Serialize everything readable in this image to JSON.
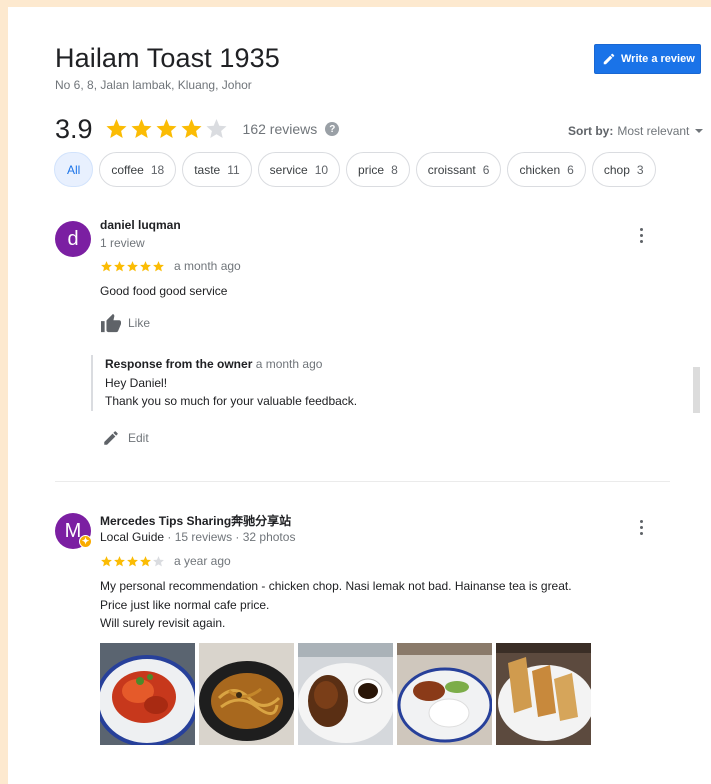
{
  "place": {
    "name": "Hailam Toast 1935",
    "address": "No 6, 8, Jalan lambak, Kluang, Johor",
    "rating": "3.9",
    "stars": 4,
    "reviews_count": "162 reviews",
    "help_icon": "?"
  },
  "write_review": {
    "label": "Write a review",
    "icon": "pencil-icon"
  },
  "sort": {
    "label": "Sort by:",
    "value": "Most relevant"
  },
  "chips": [
    {
      "label": "All",
      "count": ""
    },
    {
      "label": "coffee",
      "count": "18"
    },
    {
      "label": "taste",
      "count": "11"
    },
    {
      "label": "service",
      "count": "10"
    },
    {
      "label": "price",
      "count": "8"
    },
    {
      "label": "croissant",
      "count": "6"
    },
    {
      "label": "chicken",
      "count": "6"
    },
    {
      "label": "chop",
      "count": "3"
    }
  ],
  "reviews": [
    {
      "avatar_letter": "d",
      "avatar_color": "#7b1fa2",
      "name": "daniel luqman",
      "meta": "1 review",
      "stars": 5,
      "time": "a month ago",
      "text": "Good food good service",
      "like_label": "Like",
      "response": {
        "label": "Response from the owner",
        "time": "a month ago",
        "line1": "Hey Daniel!",
        "line2": "Thank you so much for your valuable feedback."
      },
      "edit_label": "Edit"
    },
    {
      "avatar_letter": "M",
      "avatar_color": "#7b1fa2",
      "name": "Mercedes Tips Sharing奔驰分享站",
      "guide": "Local Guide",
      "meta": " · 15 reviews · 32 photos",
      "stars": 4,
      "time": "a year ago",
      "text_line1": "My personal recommendation - chicken chop. Nasi lemak not bad. Hainanse tea is great.",
      "text_line2": "Price just like normal cafe price.",
      "text_line3": "Will surely revisit again.",
      "photos": [
        "chicken-chop-photo",
        "noodles-photo",
        "roast-chicken-photo",
        "nasi-lemak-photo",
        "toast-sandwich-photo"
      ]
    }
  ],
  "colors": {
    "star": "#fbbc04",
    "star_empty": "#dadce0",
    "accent": "#1a73e8"
  }
}
